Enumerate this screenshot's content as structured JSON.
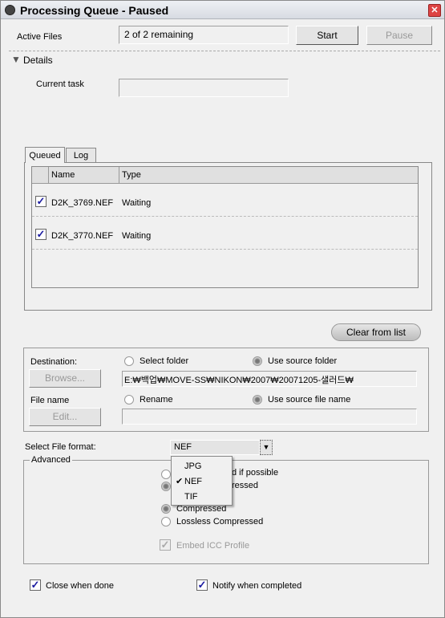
{
  "window": {
    "title": "Processing Queue - Paused"
  },
  "top": {
    "active_files_label": "Active Files",
    "active_files_value": "2 of 2 remaining",
    "start": "Start",
    "pause": "Pause",
    "details": "Details",
    "current_task_label": "Current task",
    "current_task_value": ""
  },
  "tabs": [
    {
      "label": "Queued"
    },
    {
      "label": "Log"
    }
  ],
  "table": {
    "columns": [
      "Name",
      "Type"
    ],
    "rows": [
      {
        "name": "D2K_3769.NEF",
        "type": "Waiting",
        "checked": true
      },
      {
        "name": "D2K_3770.NEF",
        "type": "Waiting",
        "checked": true
      }
    ]
  },
  "clear_button": "Clear from list",
  "destination": {
    "label": "Destination:",
    "browse": "Browse...",
    "select_folder": "Select folder",
    "use_source_folder": "Use source folder",
    "path": "E:₩백업₩MOVE-SS₩NIKON₩2007₩20071205-샐러드₩",
    "selected": "Use source folder"
  },
  "filename": {
    "label": "File name",
    "edit": "Edit...",
    "rename": "Rename",
    "use_source": "Use source file name",
    "value": "",
    "selected": "Use source file name"
  },
  "format": {
    "label": "Select File format:",
    "value": "NEF",
    "options": [
      "JPG",
      "NEF",
      "TIF"
    ],
    "checked": "NEF"
  },
  "advanced": {
    "label": "Advanced",
    "partial1": "d if possible",
    "partial2": "ressed",
    "compressed": "Compressed",
    "lossless": "Lossless Compressed",
    "embed_icc": "Embed ICC Profile"
  },
  "bottom": {
    "close_when_done": "Close when done",
    "notify": "Notify when completed"
  }
}
